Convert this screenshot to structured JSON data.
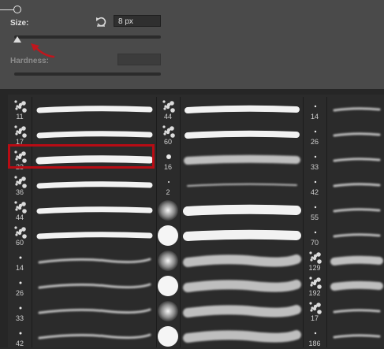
{
  "panel": {
    "size_label": "Size:",
    "size_value": "8 px",
    "size_slider_fraction": 0.0,
    "hardness_label": "Hardness:",
    "hardness_value": ""
  },
  "icons": {
    "reset": "reset-icon",
    "annotation": "red-arrow-annotation"
  },
  "colors": {
    "panel_bg": "#4a4a4a",
    "grid_bg": "#2a2a2a",
    "highlight": "#b80c14"
  },
  "brushes": {
    "col1": [
      {
        "size": "11"
      },
      {
        "size": "17"
      },
      {
        "size": "23"
      },
      {
        "size": "36"
      },
      {
        "size": "44"
      },
      {
        "size": "60"
      },
      {
        "size": "14"
      },
      {
        "size": "26"
      },
      {
        "size": "33"
      },
      {
        "size": "42"
      }
    ],
    "col2": [
      {
        "size": "44"
      },
      {
        "size": "60"
      },
      {
        "size": "16"
      },
      {
        "size": "2"
      },
      {
        "size": ""
      },
      {
        "size": ""
      },
      {
        "size": ""
      },
      {
        "size": ""
      },
      {
        "size": ""
      },
      {
        "size": ""
      }
    ],
    "col3": [
      {
        "size": "14"
      },
      {
        "size": "26"
      },
      {
        "size": "33"
      },
      {
        "size": "42"
      },
      {
        "size": "55"
      },
      {
        "size": "70"
      },
      {
        "size": "129"
      },
      {
        "size": "192"
      },
      {
        "size": "17"
      },
      {
        "size": "186"
      }
    ]
  }
}
